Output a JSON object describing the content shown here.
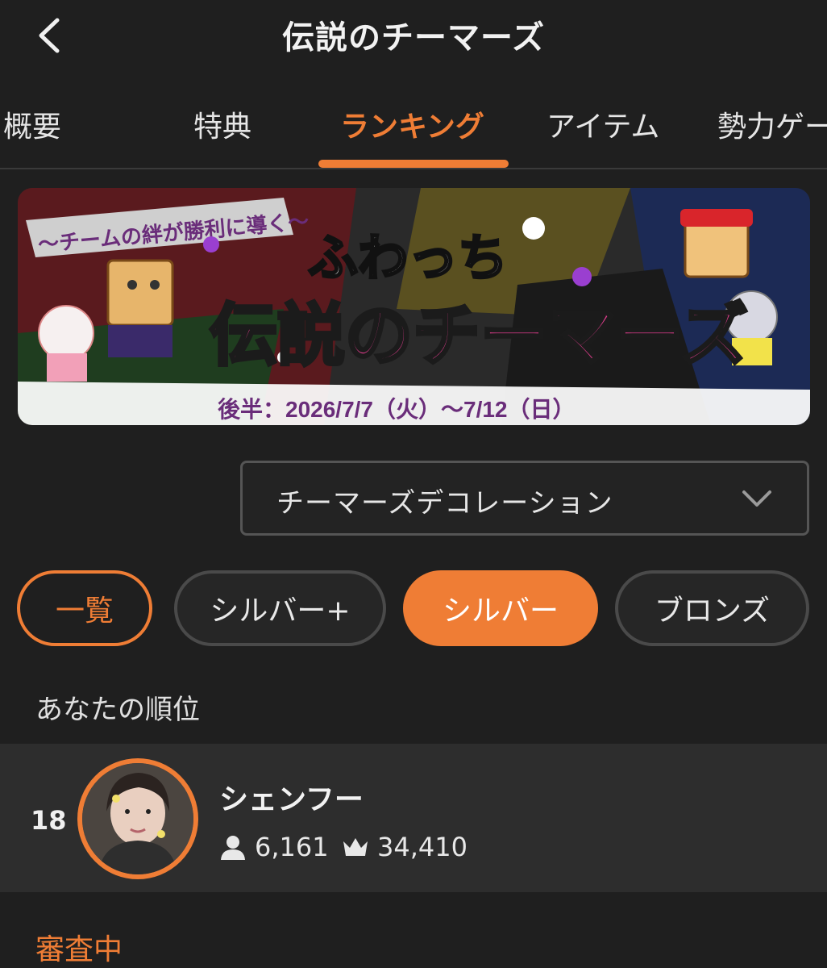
{
  "header": {
    "title": "伝説のチーマーズ",
    "back_icon": "chevron-left-icon"
  },
  "tabs": [
    {
      "label": "概要",
      "active": false
    },
    {
      "label": "特典",
      "active": false
    },
    {
      "label": "ランキング",
      "active": true
    },
    {
      "label": "アイテム",
      "active": false
    },
    {
      "label": "勢力ゲー",
      "active": false
    }
  ],
  "banner": {
    "tagline": "〜チームの絆が勝利に導く〜",
    "logo_top": "ふわっち",
    "logo_main": "伝説のチーマーズ",
    "period": "後半：2026/7/7（火）〜7/12（日）"
  },
  "dropdown": {
    "selected": "チーマーズデコレーション",
    "icon": "chevron-down-icon"
  },
  "filters": [
    {
      "label": "一覧",
      "state": "outline-accent"
    },
    {
      "label": "シルバー+",
      "state": "outline"
    },
    {
      "label": "シルバー",
      "state": "selected"
    },
    {
      "label": "ブロンズ",
      "state": "outline"
    }
  ],
  "my_rank": {
    "section_label": "あなたの順位",
    "rank": "18",
    "name": "シェンフー",
    "followers": "6,161",
    "points": "34,410"
  },
  "status_text": "審査中",
  "colors": {
    "accent": "#ef7d35",
    "background": "#1f1f1f",
    "row_background": "#2d2d2d"
  }
}
